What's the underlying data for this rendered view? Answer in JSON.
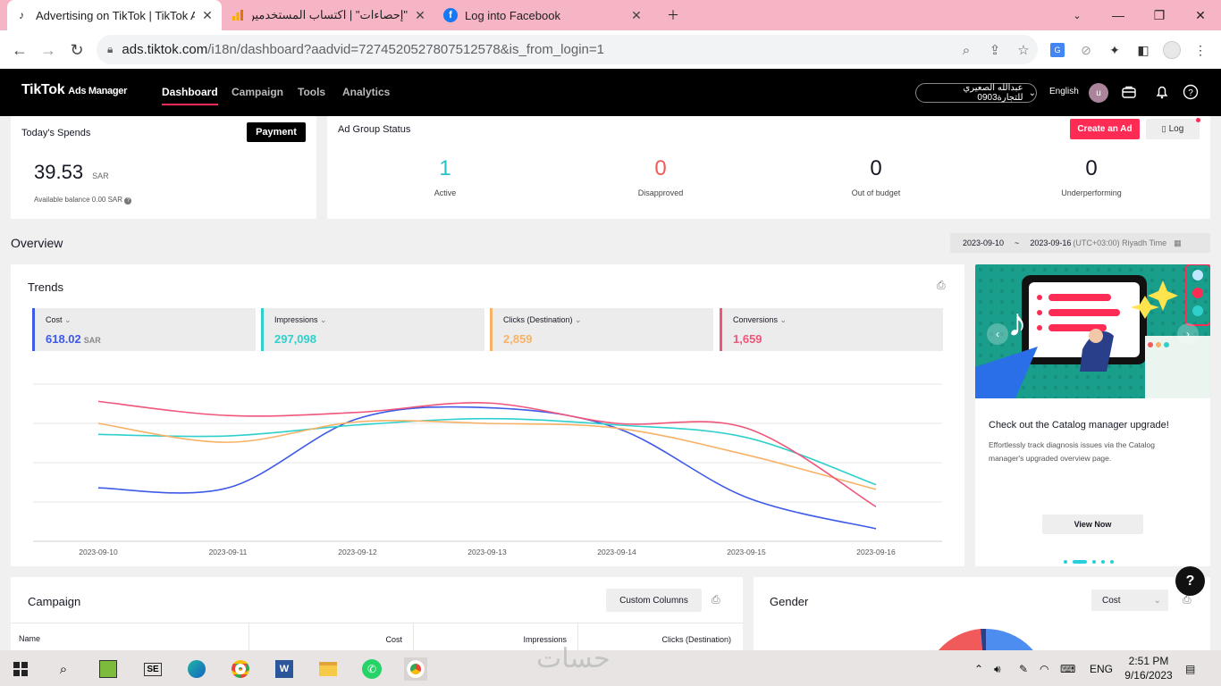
{
  "browser": {
    "tabs": [
      {
        "title": "Advertising on TikTok | TikTok Ad",
        "icon": "tiktok-icon",
        "active": true
      },
      {
        "title": "\"إحصاءات\" | اكتساب المستخدمين: ",
        "icon": "analytics-icon",
        "active": false
      },
      {
        "title": "Log into Facebook",
        "icon": "facebook-icon",
        "active": false
      }
    ],
    "url_host": "ads.tiktok.com",
    "url_path": "/i18n/dashboard?aadvid=7274520527807512578&is_from_login=1"
  },
  "topnav": {
    "logo": "TikTok",
    "logo_sub": "Ads Manager",
    "items": [
      "Dashboard",
      "Campaign",
      "Tools",
      "Analytics"
    ],
    "account": "عبدالله الصعيري للتجارة0903",
    "language": "English",
    "avatar": "u"
  },
  "spends": {
    "title": "Today's Spends",
    "payment_label": "Payment",
    "amount": "39.53",
    "currency": "SAR",
    "balance": "Available balance 0.00 SAR"
  },
  "ad_group": {
    "title": "Ad Group Status",
    "create_label": "Create an Ad",
    "log_label": "Log",
    "stats": [
      {
        "value": "1",
        "label": "Active",
        "color": "#25c2c8"
      },
      {
        "value": "0",
        "label": "Disapproved",
        "color": "#f05a5a"
      },
      {
        "value": "0",
        "label": "Out of budget",
        "color": "#161823"
      },
      {
        "value": "0",
        "label": "Underperforming",
        "color": "#161823"
      }
    ]
  },
  "overview": {
    "title": "Overview",
    "date_start": "2023-09-10",
    "date_sep": "~",
    "date_end": "2023-09-16",
    "timezone": "(UTC+03:00) Riyadh Time"
  },
  "trends": {
    "title": "Trends",
    "metrics": [
      {
        "name": "Cost",
        "value": "618.02",
        "unit": "SAR",
        "color": "#3d5ae8"
      },
      {
        "name": "Impressions",
        "value": "297,098",
        "unit": "",
        "color": "#2fd0cc"
      },
      {
        "name": "Clicks (Destination)",
        "value": "2,859",
        "unit": "",
        "color": "#f7b267"
      },
      {
        "name": "Conversions",
        "value": "1,659",
        "unit": "",
        "color": "#f0557a"
      }
    ]
  },
  "chart_data": {
    "type": "line",
    "x": [
      "2023-09-10",
      "2023-09-11",
      "2023-09-12",
      "2023-09-13",
      "2023-09-14",
      "2023-09-15",
      "2023-09-16"
    ],
    "normalized": true,
    "ylim": [
      0,
      1
    ],
    "grid": true,
    "series": [
      {
        "name": "Cost",
        "color": "#3d5ae8",
        "values": [
          0.34,
          0.34,
          0.78,
          0.85,
          0.72,
          0.28,
          0.08
        ]
      },
      {
        "name": "Impressions",
        "color": "#2fd0cc",
        "values": [
          0.68,
          0.67,
          0.74,
          0.78,
          0.74,
          0.66,
          0.36
        ]
      },
      {
        "name": "Clicks (Destination)",
        "color": "#f7b267",
        "values": [
          0.75,
          0.63,
          0.76,
          0.75,
          0.72,
          0.55,
          0.33
        ]
      },
      {
        "name": "Conversions",
        "color": "#f0557a",
        "values": [
          0.89,
          0.8,
          0.82,
          0.88,
          0.75,
          0.72,
          0.22
        ]
      }
    ]
  },
  "promo": {
    "title": "Check out the Catalog manager upgrade!",
    "desc": "Effortlessly track diagnosis issues via the Catalog manager's upgraded overview page.",
    "button": "View Now"
  },
  "campaign": {
    "title": "Campaign",
    "custom_columns": "Custom Columns",
    "columns": [
      "Name",
      "Cost",
      "Impressions",
      "Clicks (Destination)"
    ]
  },
  "gender": {
    "title": "Gender",
    "select": "Cost"
  },
  "taskbar": {
    "lang": "ENG",
    "time": "2:51 PM",
    "date": "9/16/2023"
  },
  "watermark": "حسات"
}
